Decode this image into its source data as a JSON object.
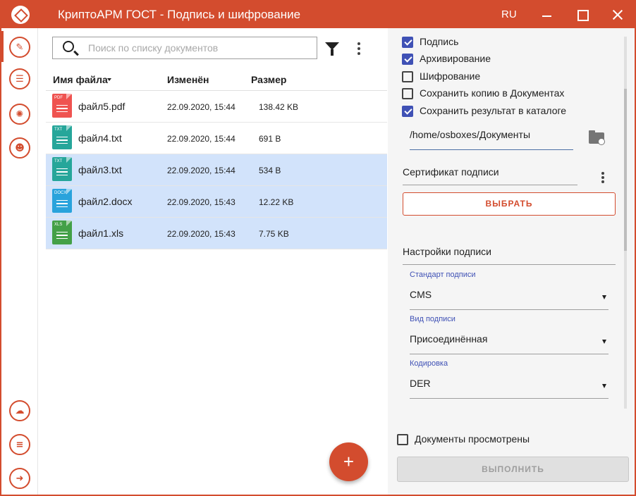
{
  "window": {
    "title": "КриптоАРМ ГОСТ - Подпись и шифрование",
    "language": "RU"
  },
  "colors": {
    "accent": "#d34c2e",
    "selection": "#d2e3fb",
    "checkbox": "#3f51b5"
  },
  "sidebar": {
    "items": [
      {
        "icon": "signature-icon",
        "glyph": "✎"
      },
      {
        "icon": "documents-icon",
        "glyph": "☰"
      },
      {
        "icon": "certificates-icon",
        "glyph": "✺"
      },
      {
        "icon": "contacts-icon",
        "glyph": "☻"
      },
      {
        "icon": "cloud-icon",
        "glyph": "☁"
      },
      {
        "icon": "journal-icon",
        "glyph": "≡"
      },
      {
        "icon": "exit-icon",
        "glyph": "➜"
      }
    ]
  },
  "search": {
    "placeholder": "Поиск по списку документов",
    "value": ""
  },
  "table": {
    "columns": {
      "name": "Имя файла",
      "modified": "Изменён",
      "size": "Размер"
    },
    "rows": [
      {
        "ext": "PDF",
        "name": "файл5.pdf",
        "modified": "22.09.2020, 15:44",
        "size": "138.42 KB",
        "selected": false,
        "color": "#ef5350"
      },
      {
        "ext": "TXT",
        "name": "файл4.txt",
        "modified": "22.09.2020, 15:44",
        "size": "691 B",
        "selected": false,
        "color": "#26a69a"
      },
      {
        "ext": "TXT",
        "name": "файл3.txt",
        "modified": "22.09.2020, 15:44",
        "size": "534 B",
        "selected": true,
        "color": "#26a69a"
      },
      {
        "ext": "DOCX",
        "name": "файл2.docx",
        "modified": "22.09.2020, 15:43",
        "size": "12.22 KB",
        "selected": true,
        "color": "#29a3dc"
      },
      {
        "ext": "XLS",
        "name": "файл1.xls",
        "modified": "22.09.2020, 15:43",
        "size": "7.75 KB",
        "selected": true,
        "color": "#43a047"
      }
    ]
  },
  "fab": {
    "label": "+"
  },
  "panel": {
    "options": [
      {
        "label": "Подпись",
        "checked": true
      },
      {
        "label": "Архивирование",
        "checked": true
      },
      {
        "label": "Шифрование",
        "checked": false
      },
      {
        "label": "Сохранить копию в Документах",
        "checked": false
      },
      {
        "label": "Сохранить результат в каталоге",
        "checked": true
      }
    ],
    "output_path": "/home/osboxes/Документы",
    "certificate_label": "Сертификат подписи",
    "choose_button": "ВЫБРАТЬ",
    "sign_settings_title": "Настройки подписи",
    "fields": [
      {
        "label": "Стандарт подписи",
        "value": "CMS"
      },
      {
        "label": "Вид подписи",
        "value": "Присоединённая"
      },
      {
        "label": "Кодировка",
        "value": "DER"
      }
    ],
    "documents_viewed": {
      "label": "Документы просмотрены",
      "checked": false
    },
    "execute_button": "ВЫПОЛНИТЬ"
  }
}
